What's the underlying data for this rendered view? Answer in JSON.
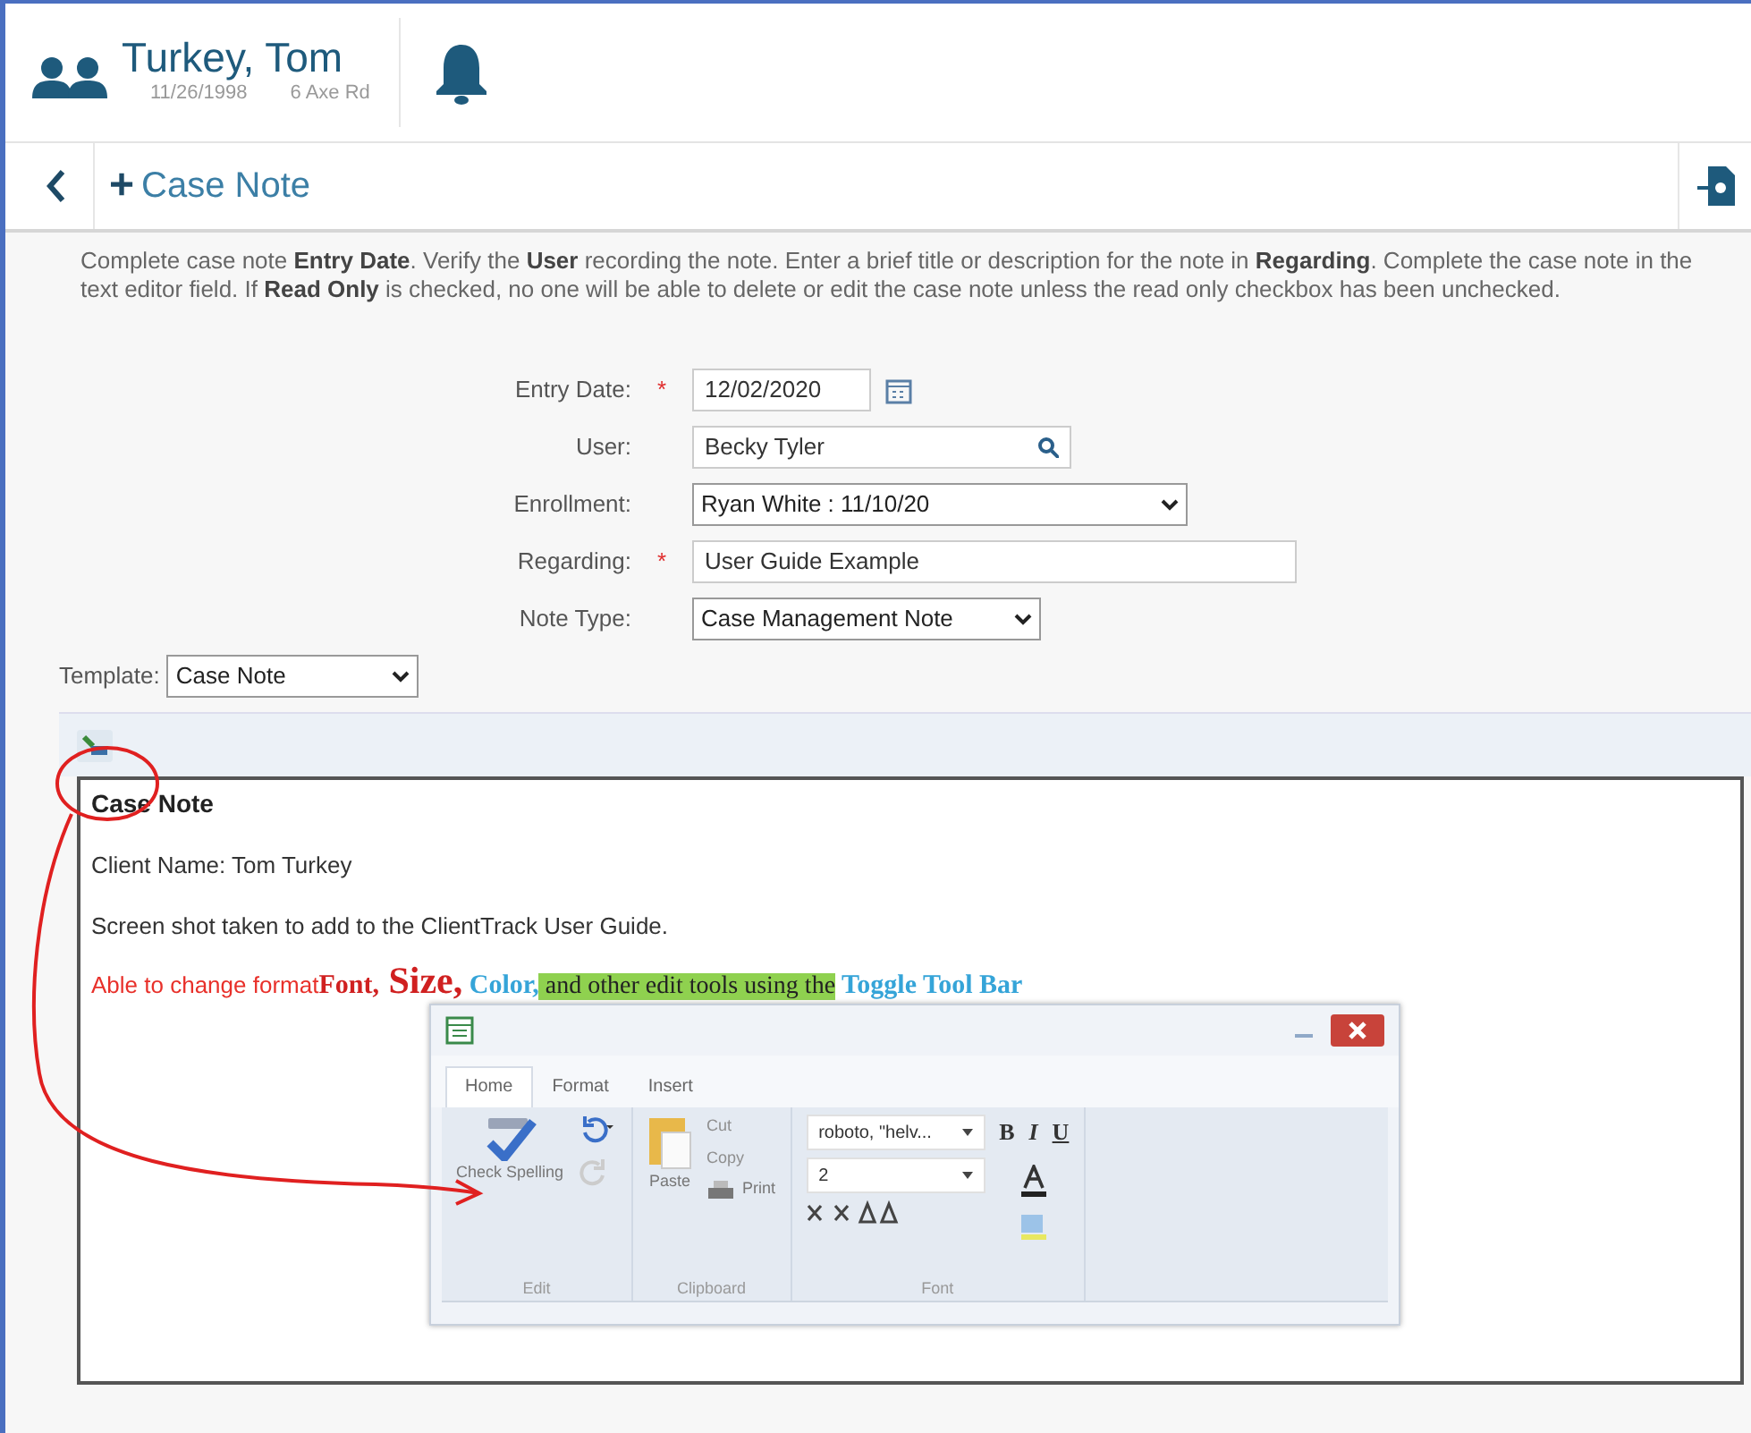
{
  "client": {
    "name": "Turkey, Tom",
    "dob": "11/26/1998",
    "address": "6 Axe Rd"
  },
  "page": {
    "plus": "+",
    "title": "Case Note"
  },
  "instructions": "Complete case note **Entry Date**.  Verify the **User** recording the note.  Enter a brief title or description for the note in **Regarding**.  Complete the case note in the text editor field. If **Read Only** is checked, no one will be able to delete or edit the case note unless the read only checkbox has been unchecked.",
  "fields": [
    {
      "label": "Entry Date:",
      "required": true,
      "kind": "date",
      "value": "12/02/2020"
    },
    {
      "label": "User:",
      "required": false,
      "kind": "lookup",
      "value": "Becky Tyler"
    },
    {
      "label": "Enrollment:",
      "required": false,
      "kind": "select",
      "value": "Ryan White : 11/10/20"
    },
    {
      "label": "Regarding:",
      "required": true,
      "kind": "text",
      "value": "User Guide Example"
    },
    {
      "label": "Note Type:",
      "required": false,
      "kind": "select-short",
      "value": "Case Management Note"
    }
  ],
  "required_mark": "*",
  "template": {
    "label": "Template:",
    "value": "Case Note"
  },
  "editor": {
    "heading": "Case Note",
    "lines": [
      [
        {
          "text": "Client Name: Tom Turkey",
          "kind": "sans",
          "color": "#333333"
        }
      ],
      [
        {
          "text": "Screen shot taken to add to the ClientTrack User Guide.",
          "kind": "sans",
          "color": "#333333"
        }
      ],
      [
        {
          "text": "Able to change format",
          "kind": "sans",
          "color": "#e8302a"
        },
        {
          "text": "Font,",
          "kind": "serif",
          "color": "#d02020"
        },
        {
          "text": " Size,",
          "kind": "serif-large",
          "color": "#d02020"
        },
        {
          "text": " Color,",
          "kind": "serif",
          "color": "#35a4d8"
        },
        {
          "text": " and other edit tools using the",
          "kind": "highlight",
          "color": "#8fd14f"
        },
        {
          "text": " Toggle Tool Bar",
          "kind": "serif",
          "color": "#35a4d8"
        }
      ]
    ]
  },
  "toolbar": {
    "tabs": [
      {
        "label": "Home",
        "selected": true
      },
      {
        "label": "Format",
        "selected": false
      },
      {
        "label": "Insert",
        "selected": false
      }
    ],
    "groups": [
      {
        "name": "Edit",
        "kind": "edit",
        "items": [
          {
            "label": "Check Spelling",
            "disabled": false
          }
        ]
      },
      {
        "name": "Clipboard",
        "kind": "clipboard",
        "items": [
          {
            "label": "Paste",
            "disabled": false
          },
          {
            "label": "Cut",
            "disabled": true
          },
          {
            "label": "Copy",
            "disabled": true
          },
          {
            "label": "Print",
            "disabled": false
          }
        ]
      },
      {
        "name": "Font",
        "kind": "font",
        "items": [
          {
            "label": "roboto, \"helv..."
          },
          {
            "label": "2"
          }
        ],
        "format_buttons": [
          "B",
          "I",
          "U"
        ]
      }
    ]
  }
}
